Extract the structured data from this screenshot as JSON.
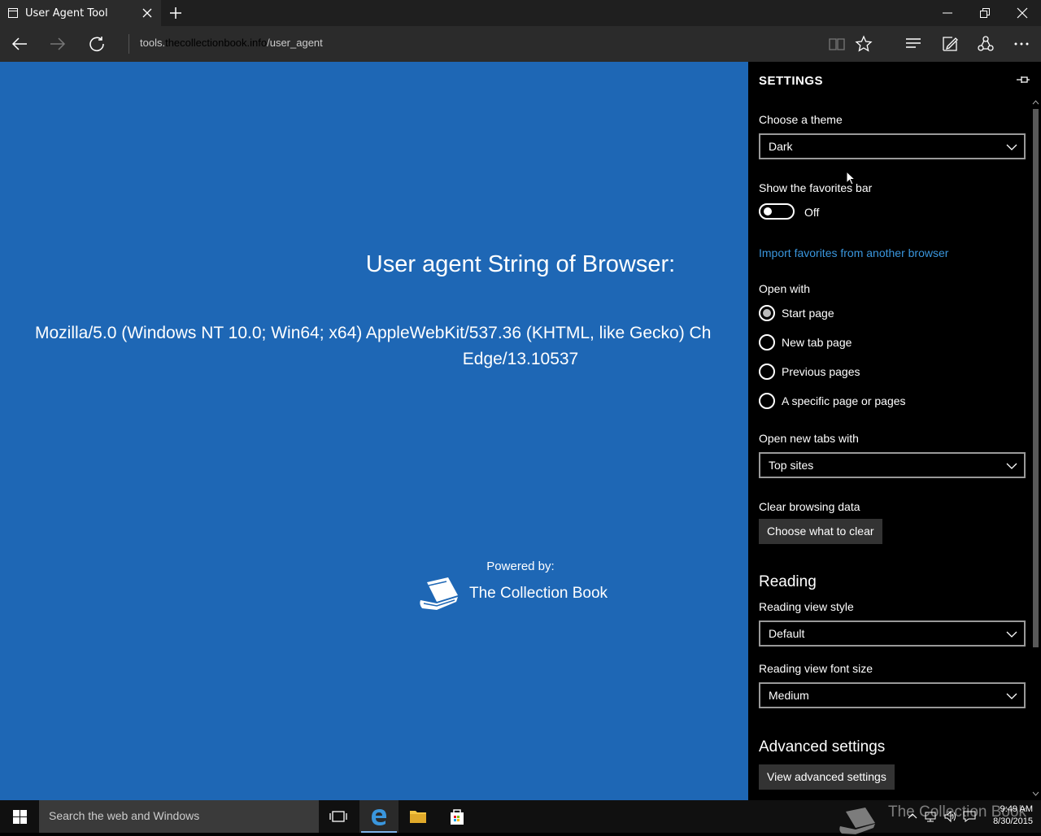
{
  "browser": {
    "tab_title": "User Agent Tool",
    "url_prefix": "tools.",
    "url_domain": "thecollectionbook.info",
    "url_path": "/user_agent"
  },
  "page": {
    "heading": "User agent String of Browser:",
    "ua_line1": "Mozilla/5.0 (Windows NT 10.0; Win64; x64) AppleWebKit/537.36 (KHTML, like Gecko) Ch",
    "ua_line2": "Edge/13.10537",
    "powered_by": "Powered by:",
    "brand": "The Collection Book"
  },
  "settings": {
    "title": "SETTINGS",
    "theme_label": "Choose a theme",
    "theme_value": "Dark",
    "favbar_label": "Show the favorites bar",
    "favbar_state": "Off",
    "import_link": "Import favorites from another browser",
    "open_with_label": "Open with",
    "open_with_options": [
      "Start page",
      "New tab page",
      "Previous pages",
      "A specific page or pages"
    ],
    "open_with_selected": 0,
    "new_tabs_label": "Open new tabs with",
    "new_tabs_value": "Top sites",
    "clear_label": "Clear browsing data",
    "clear_button": "Choose what to clear",
    "reading_heading": "Reading",
    "reading_style_label": "Reading view style",
    "reading_style_value": "Default",
    "reading_font_label": "Reading view font size",
    "reading_font_value": "Medium",
    "advanced_heading": "Advanced settings",
    "advanced_button": "View advanced settings"
  },
  "taskbar": {
    "search_placeholder": "Search the web and Windows",
    "watermark": "The Collection Book",
    "time": "9:49 AM",
    "date": "8/30/2015"
  },
  "colors": {
    "page_bg": "#1e67b5",
    "link": "#3a96dd",
    "panel_bg": "#000000"
  }
}
